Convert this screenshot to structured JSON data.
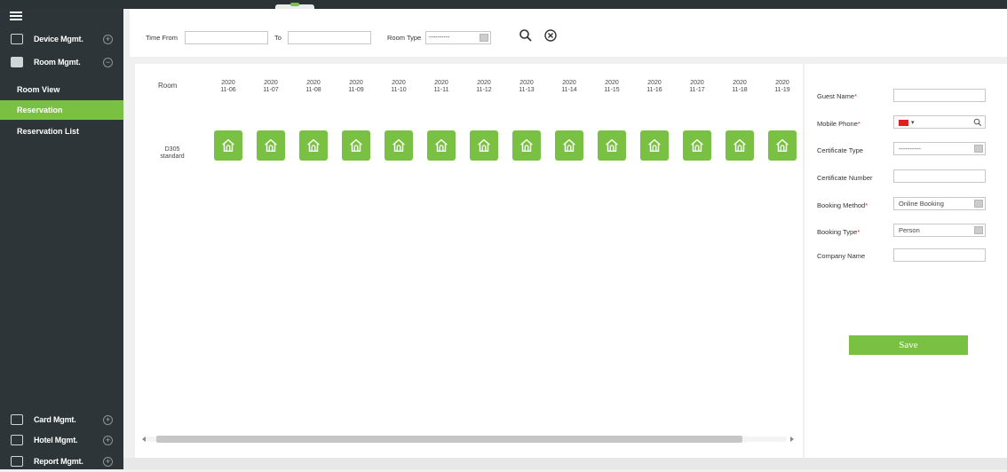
{
  "sidebar": {
    "modules": {
      "device": "Device Mgmt.",
      "room": "Room Mgmt.",
      "card": "Card Mgmt.",
      "hotel": "Hotel Mgmt.",
      "report": "Report Mgmt."
    },
    "room_sub": [
      {
        "label": "Room View",
        "active": false
      },
      {
        "label": "Reservation",
        "active": true
      },
      {
        "label": "Reservation List",
        "active": false
      }
    ],
    "accent": "#7ac143",
    "bg": "#2d3538"
  },
  "filter": {
    "time_from_label": "Time From",
    "to_label": "To",
    "room_type_label": "Room Type",
    "room_type_value": "----------",
    "time_from_value": "",
    "to_value": ""
  },
  "grid": {
    "room_header": "Room",
    "dates": [
      {
        "y": "2020",
        "md": "11-06"
      },
      {
        "y": "2020",
        "md": "11-07"
      },
      {
        "y": "2020",
        "md": "11-08"
      },
      {
        "y": "2020",
        "md": "11-09"
      },
      {
        "y": "2020",
        "md": "11-10"
      },
      {
        "y": "2020",
        "md": "11-11"
      },
      {
        "y": "2020",
        "md": "11-12"
      },
      {
        "y": "2020",
        "md": "11-13"
      },
      {
        "y": "2020",
        "md": "11-14"
      },
      {
        "y": "2020",
        "md": "11-15"
      },
      {
        "y": "2020",
        "md": "11-16"
      },
      {
        "y": "2020",
        "md": "11-17"
      },
      {
        "y": "2020",
        "md": "11-18"
      },
      {
        "y": "2020",
        "md": "11-19"
      }
    ],
    "rooms": [
      {
        "number": "D305",
        "type": "standard",
        "cells_icon": "house-icon"
      }
    ]
  },
  "form": {
    "guest_name_label": "Guest Name",
    "mobile_phone_label": "Mobile Phone",
    "certificate_type_label": "Certificate Type",
    "certificate_type_value": "----------",
    "certificate_number_label": "Certificate Number",
    "booking_method_label": "Booking Method",
    "booking_method_value": "Online Booking",
    "booking_type_label": "Booking Type",
    "booking_type_value": "Person",
    "company_name_label": "Company Name",
    "required_mark": "*",
    "save_label": "Save"
  }
}
